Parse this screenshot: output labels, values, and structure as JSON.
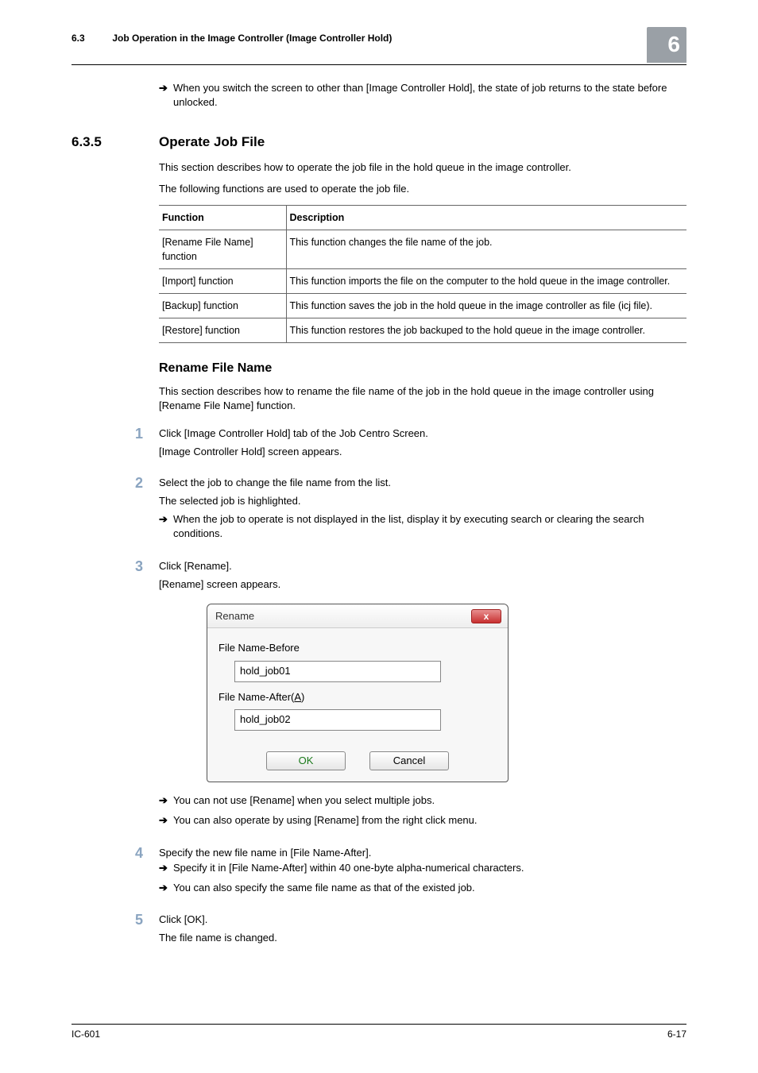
{
  "header": {
    "section_num": "6.3",
    "section_title": "Job Operation in the Image Controller (Image Controller Hold)",
    "chapter": "6"
  },
  "intro_note": "When you switch the screen to other than [Image Controller Hold], the state of job returns to the state before unlocked.",
  "s635": {
    "num": "6.3.5",
    "title": "Operate Job File",
    "p1": "This section describes how to operate the job file in the hold queue in the image controller.",
    "p2": "The following functions are used to operate the job file."
  },
  "func_table": {
    "head_func": "Function",
    "head_desc": "Description",
    "rows": [
      {
        "f": "[Rename File Name] function",
        "d": "This function changes the file name of the job."
      },
      {
        "f": "[Import] function",
        "d": "This function imports the file on the computer to the hold queue in the image controller."
      },
      {
        "f": "[Backup] function",
        "d": "This function saves the job in the hold queue in the image controller as file (icj file)."
      },
      {
        "f": "[Restore] function",
        "d": "This function restores the job backuped to the hold queue in the image controller."
      }
    ]
  },
  "rename": {
    "title": "Rename File Name",
    "intro": "This section describes how to rename the file name of the job in the hold queue in the image controller using [Rename File Name] function.",
    "step1": {
      "n": "1",
      "text": "Click [Image Controller Hold] tab of the Job Centro Screen.",
      "sub": "[Image Controller Hold] screen appears."
    },
    "step2": {
      "n": "2",
      "text": "Select the job to change the file name from the list.",
      "sub1": "The selected job is highlighted.",
      "sub2": "When the job to operate is not displayed in the list, display it by executing search or clearing the search conditions."
    },
    "step3": {
      "n": "3",
      "text": "Click [Rename].",
      "sub": "[Rename] screen appears.",
      "note1": "You can not use [Rename] when you select multiple jobs.",
      "note2": "You can also operate by using [Rename] from the right click menu."
    },
    "step4": {
      "n": "4",
      "text": "Specify the new file name in [File Name-After].",
      "sub1": "Specify it in [File Name-After] within 40 one-byte alpha-numerical characters.",
      "sub2": "You can also specify the same file name as that of the existed job."
    },
    "step5": {
      "n": "5",
      "text": "Click [OK].",
      "sub": "The file name is changed."
    }
  },
  "dialog": {
    "title": "Rename",
    "close_glyph": "x",
    "label_before": "File Name-Before",
    "value_before": "hold_job01",
    "label_after_pre": "File Name-After(",
    "label_after_u": "A",
    "label_after_post": ")",
    "value_after": "hold_job02",
    "ok": "OK",
    "cancel": "Cancel"
  },
  "footer": {
    "left": "IC-601",
    "right": "6-17"
  }
}
